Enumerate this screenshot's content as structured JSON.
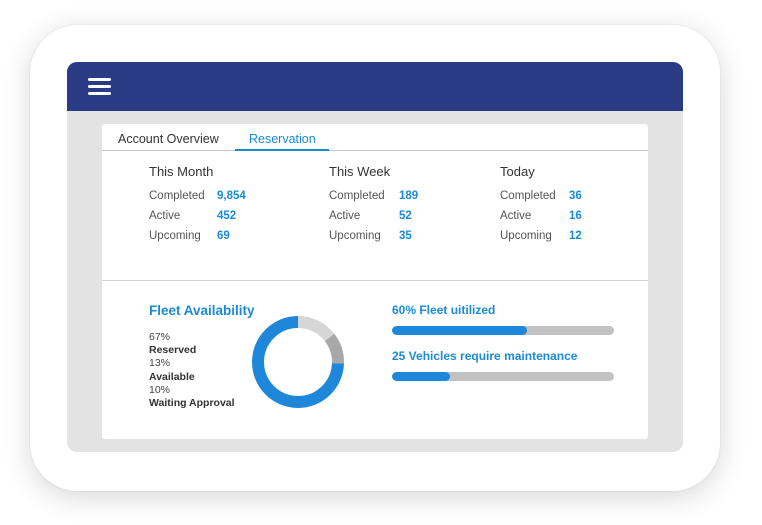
{
  "tabs": [
    {
      "label": "Account Overview",
      "active": false
    },
    {
      "label": "Reservation",
      "active": true
    }
  ],
  "stats": [
    {
      "heading": "This Month",
      "rows": [
        {
          "label": "Completed",
          "value": "9,854"
        },
        {
          "label": "Active",
          "value": "452"
        },
        {
          "label": "Upcoming",
          "value": "69"
        }
      ]
    },
    {
      "heading": "This Week",
      "rows": [
        {
          "label": "Completed",
          "value": "189"
        },
        {
          "label": "Active",
          "value": "52"
        },
        {
          "label": "Upcoming",
          "value": "35"
        }
      ]
    },
    {
      "heading": "Today",
      "rows": [
        {
          "label": "Completed",
          "value": "36"
        },
        {
          "label": "Active",
          "value": "16"
        },
        {
          "label": "Upcoming",
          "value": "12"
        }
      ]
    }
  ],
  "fleet": {
    "title": "Fleet Availability",
    "legend": [
      {
        "percent": "67%",
        "label": "Reserved"
      },
      {
        "percent": "13%",
        "label": "Available"
      },
      {
        "percent": "10%",
        "label": "Waiting Approval"
      }
    ],
    "donut": [
      {
        "label": "Reserved",
        "value": 67,
        "color": "#1e87d9"
      },
      {
        "label": "Available",
        "value": 13,
        "color": "#d6d6d6"
      },
      {
        "label": "Waiting Approval",
        "value": 10,
        "color": "#a8a8a8"
      }
    ]
  },
  "utilization": [
    {
      "label": "60% Fleet uitilized",
      "fill_fraction": 0.61
    },
    {
      "label": "25 Vehicles require maintenance",
      "fill_fraction": 0.26
    }
  ],
  "colors": {
    "header": "#283b84",
    "accent": "#1e87d9",
    "screen_bg": "#e3e3e3"
  },
  "icons": {
    "menu": "hamburger-menu-icon"
  }
}
